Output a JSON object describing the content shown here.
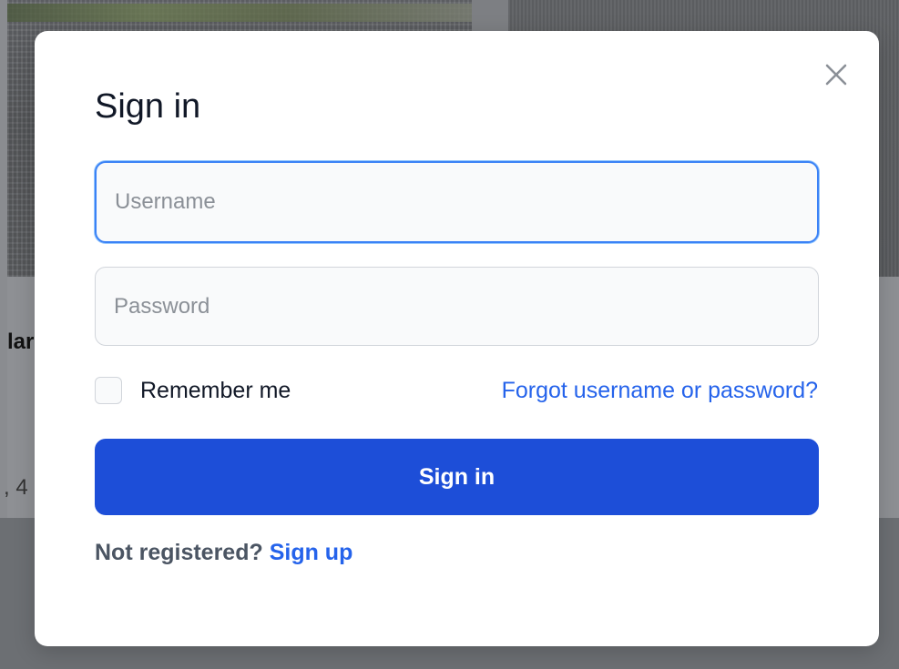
{
  "background": {
    "fragment_1": "lar",
    "fragment_2": ", 4"
  },
  "modal": {
    "title": "Sign in",
    "close_icon": "close-icon",
    "username": {
      "placeholder": "Username",
      "value": ""
    },
    "password": {
      "placeholder": "Password",
      "value": ""
    },
    "remember_me": {
      "label": "Remember me",
      "checked": false
    },
    "forgot_link": "Forgot username or password?",
    "submit_label": "Sign in",
    "register_prompt": "Not registered?",
    "signup_link": "Sign up"
  },
  "colors": {
    "primary": "#1d4ed8",
    "link": "#2563eb",
    "focus_border": "#3b82f6",
    "overlay": "#8a8c90"
  }
}
